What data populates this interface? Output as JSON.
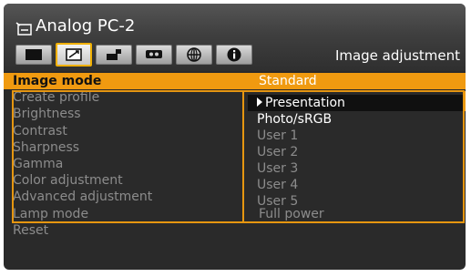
{
  "header": {
    "source_name": "Analog PC-2",
    "tab_title": "Image adjustment",
    "tabs": [
      {
        "icon": "screen-icon"
      },
      {
        "icon": "image-adjust-icon"
      },
      {
        "icon": "install-icon"
      },
      {
        "icon": "system-icon"
      },
      {
        "icon": "network-icon"
      },
      {
        "icon": "info-icon"
      }
    ]
  },
  "menu": {
    "items": [
      {
        "label": "Image mode",
        "value": "Standard",
        "selected": true
      },
      {
        "label": "Create profile",
        "value": ""
      },
      {
        "label": "Brightness",
        "value": ""
      },
      {
        "label": "Contrast",
        "value": ""
      },
      {
        "label": "Sharpness",
        "value": ""
      },
      {
        "label": "Gamma",
        "value": ""
      },
      {
        "label": "Color adjustment",
        "value": ""
      },
      {
        "label": "Advanced adjustment",
        "value": ""
      },
      {
        "label": "Lamp mode",
        "value": "Full power"
      },
      {
        "label": "Reset",
        "value": ""
      }
    ]
  },
  "dropdown": {
    "options": [
      {
        "label": "Presentation",
        "state": "highlighted"
      },
      {
        "label": "Photo/sRGB",
        "state": "enabled"
      },
      {
        "label": "User 1",
        "state": "disabled"
      },
      {
        "label": "User 2",
        "state": "disabled"
      },
      {
        "label": "User 3",
        "state": "disabled"
      },
      {
        "label": "User 4",
        "state": "disabled"
      },
      {
        "label": "User 5",
        "state": "disabled"
      }
    ]
  },
  "colors": {
    "accent": "#f09a10",
    "bg": "#2a2a2a",
    "text_dim": "#8c8c8c"
  }
}
